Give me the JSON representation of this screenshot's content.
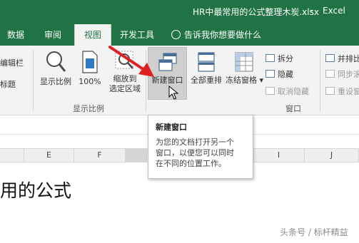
{
  "window": {
    "title": "HR中最常用的公式整理木炭.xlsx",
    "separator": "-",
    "app": "Excel"
  },
  "tabs": [
    {
      "label": "数据"
    },
    {
      "label": "审阅"
    },
    {
      "label": "视图",
      "active": true
    },
    {
      "label": "开发工具"
    }
  ],
  "tell_me": "告诉我你想要做什么",
  "ribbon": {
    "partial_left": [
      "编辑栏",
      "标题"
    ],
    "zoom_group": {
      "label": "显示比例",
      "buttons": [
        "显示比例",
        "100%",
        "缩放到",
        "选定区域"
      ]
    },
    "window_group": {
      "label": "窗口",
      "new_window": "新建窗口",
      "arrange_all": "全部重排",
      "freeze_panes": "冻结窗格",
      "split": "拆分",
      "hide": "隐藏",
      "unhide": "取消隐藏",
      "side_by_side": "并排比",
      "sync_scroll": "同步滚",
      "reset_position": "重设窗"
    }
  },
  "columns": [
    "E",
    "F",
    "",
    "I",
    "J"
  ],
  "cell_text": "用的公式",
  "tooltip": {
    "title": "新建窗口",
    "lines": [
      "为您的文档打开另一个",
      "窗口，以便您可以同时",
      "在不同的位置工作。"
    ]
  },
  "watermark": "头条号 / 标杆精益",
  "colors": {
    "excel_green": "#217346",
    "arrow_red": "#e02020"
  }
}
